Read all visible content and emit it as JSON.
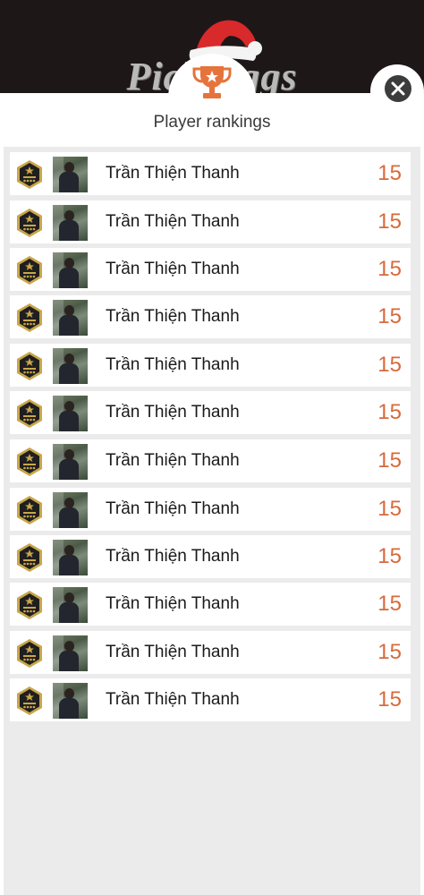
{
  "header": {
    "logo_text": "Pick Eggs"
  },
  "panel": {
    "title": "Player rankings"
  },
  "colors": {
    "header_bg": "#1e1718",
    "trophy": "#e5743c",
    "score": "#d8693a",
    "badge_gold": "#c9a64a",
    "list_bg": "#ebebeb"
  },
  "icons": {
    "trophy": "trophy-icon",
    "close": "close-icon",
    "badge": "rank-badge-icon",
    "hat": "santa-hat-icon"
  },
  "rankings": [
    {
      "name": "Trần Thiện Thanh",
      "score": "15"
    },
    {
      "name": "Trần Thiện Thanh",
      "score": "15"
    },
    {
      "name": "Trần Thiện Thanh",
      "score": "15"
    },
    {
      "name": "Trần Thiện Thanh",
      "score": "15"
    },
    {
      "name": "Trần Thiện Thanh",
      "score": "15"
    },
    {
      "name": "Trần Thiện Thanh",
      "score": "15"
    },
    {
      "name": "Trần Thiện Thanh",
      "score": "15"
    },
    {
      "name": "Trần Thiện Thanh",
      "score": "15"
    },
    {
      "name": "Trần Thiện Thanh",
      "score": "15"
    },
    {
      "name": "Trần Thiện Thanh",
      "score": "15"
    },
    {
      "name": "Trần Thiện Thanh",
      "score": "15"
    },
    {
      "name": "Trần Thiện Thanh",
      "score": "15"
    }
  ]
}
